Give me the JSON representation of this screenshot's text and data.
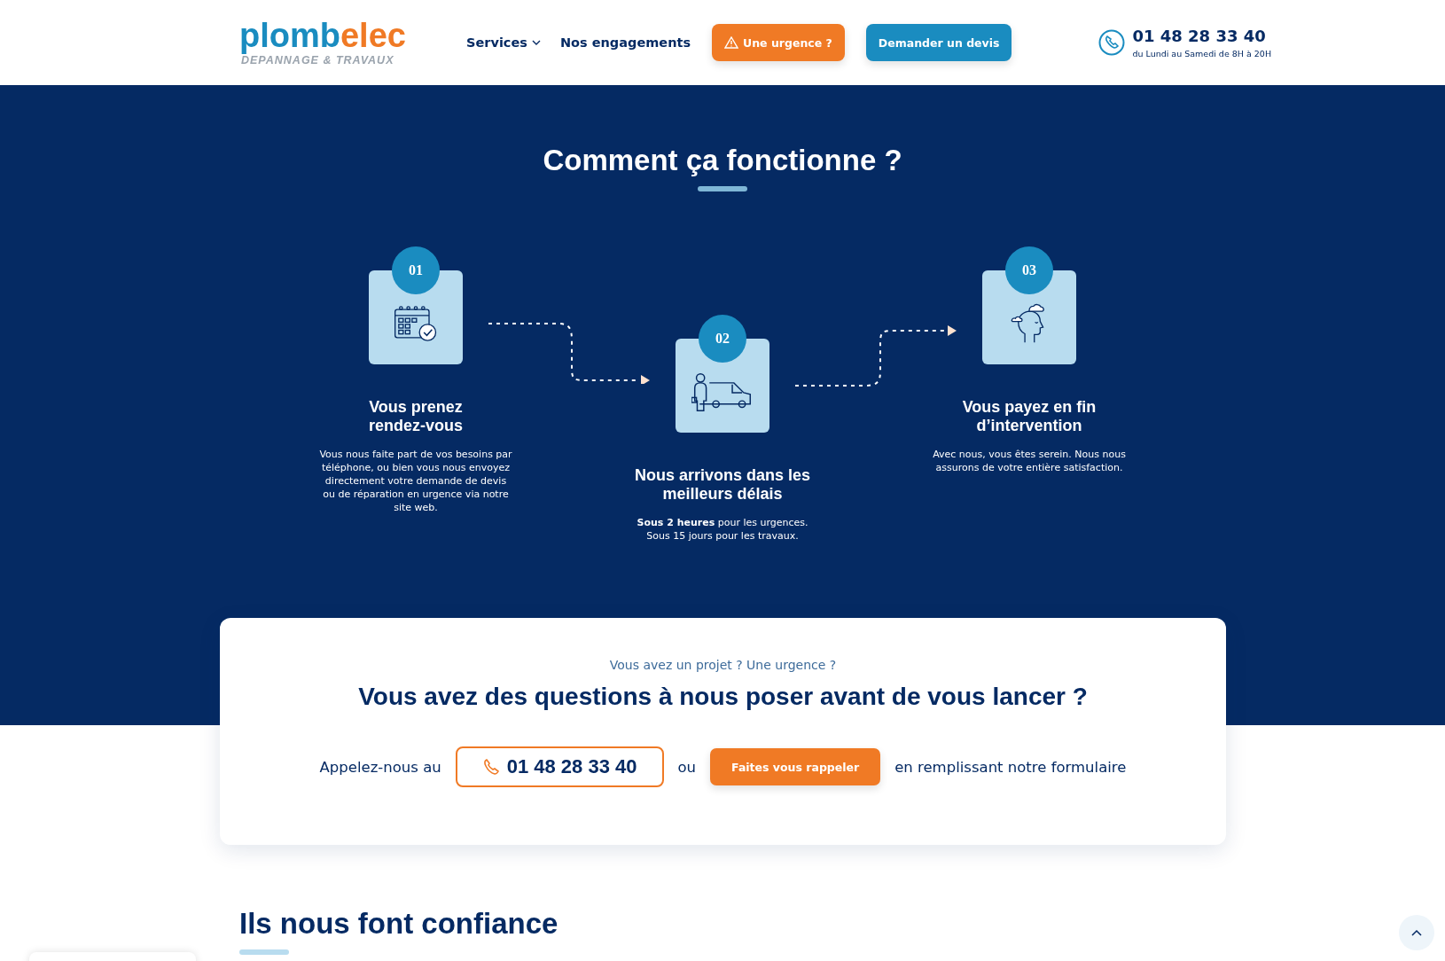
{
  "header": {
    "logo": {
      "part_1": "plomb",
      "part_2": "elec",
      "tagline": "DEPANNAGE & TRAVAUX"
    },
    "nav": [
      {
        "label": "Services",
        "dropdown": true
      },
      {
        "label": "Nos engagements",
        "dropdown": false
      }
    ],
    "buttons": [
      {
        "label": "Une urgence ?",
        "kind": "urgent"
      },
      {
        "label": "Demander un devis",
        "kind": "quote"
      }
    ],
    "phone": {
      "number": "01 48 28 33 40",
      "hours": "du Lundi au Samedi de 8H à 20H"
    }
  },
  "how": {
    "title": "Comment ça fonctionne ?",
    "steps": [
      {
        "number": "01",
        "title": "Vous prenez rendez-vous",
        "text": "Vous nous faite part de vos besoins par téléphone, ou bien vous nous envoyez directement votre demande de devis ou de réparation en urgence via notre site web."
      },
      {
        "number": "02",
        "title": "Nous arrivons dans les meilleurs délais",
        "text": "**Sous 2 heures** pour les urgences. Sous 15 jours pour les travaux."
      },
      {
        "number": "03",
        "title": "Vous payez en fin d’intervention",
        "text": "Avec nous, vous êtes serein. Nous nous assurons de votre entière satisfaction."
      }
    ]
  },
  "contact": {
    "eyebrow": "Vous avez un projet ? Une urgence ?",
    "title": "Vous avez des questions à nous poser avant de vous lancer ?",
    "call_label": "Appelez-nous au",
    "phone": "01 48 28 33 40",
    "or": "ou",
    "callback_button": "Faites vous rappeler",
    "form_label": "en remplissant notre formulaire"
  },
  "trust": {
    "title": "Ils nous font confiance"
  }
}
